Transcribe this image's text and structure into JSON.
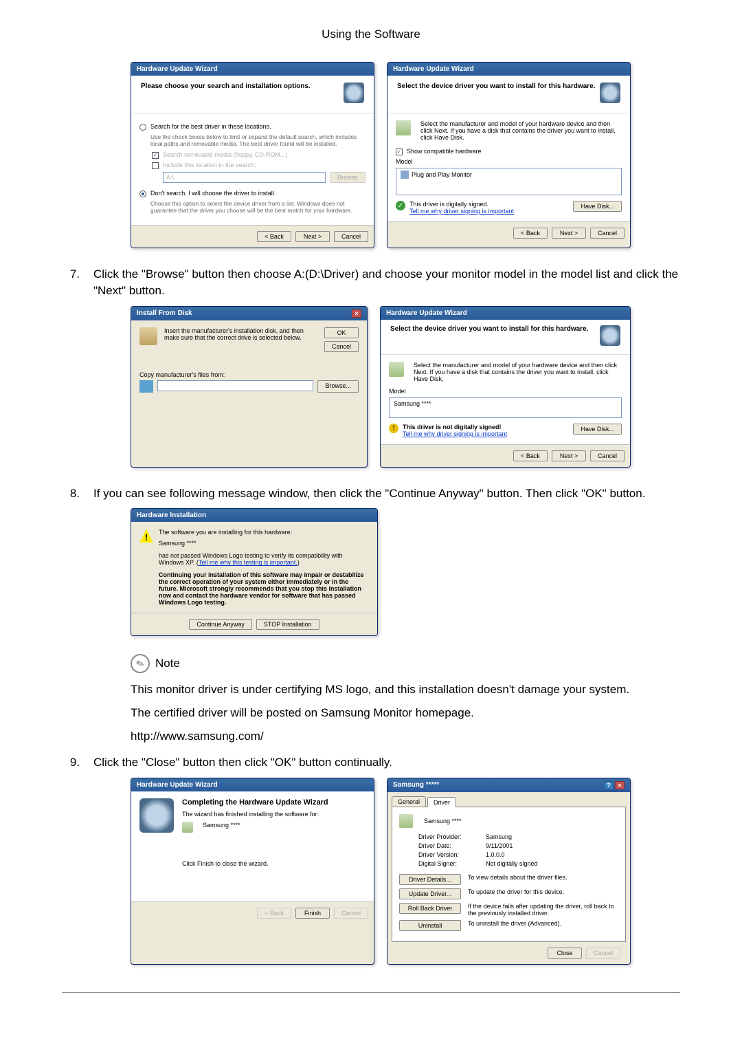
{
  "page_title": "Using the Software",
  "dlg1": {
    "title": "Hardware Update Wizard",
    "heading": "Please choose your search and installation options.",
    "radio1": "Search for the best driver in these locations.",
    "radio1_sub": "Use the check boxes below to limit or expand the default search, which includes local paths and removable media. The best driver found will be installed.",
    "chk1": "Search removable media (floppy, CD-ROM...)",
    "chk2": "Include this location in the search:",
    "path": "A:\\",
    "browse": "Browse",
    "radio2": "Don't search. I will choose the driver to install.",
    "radio2_sub": "Choose this option to select the device driver from a list. Windows does not guarantee that the driver you choose will be the best match for your hardware.",
    "back": "< Back",
    "next": "Next >",
    "cancel": "Cancel"
  },
  "dlg2": {
    "title": "Hardware Update Wizard",
    "heading": "Select the device driver you want to install for this hardware.",
    "instruction": "Select the manufacturer and model of your hardware device and then click Next. If you have a disk that contains the driver you want to install, click Have Disk.",
    "show_compat": "Show compatible hardware",
    "model_lbl": "Model",
    "model_item": "Plug and Play Monitor",
    "signed": "This driver is digitally signed.",
    "tell_me": "Tell me why driver signing is important",
    "have_disk": "Have Disk...",
    "back": "< Back",
    "next": "Next >",
    "cancel": "Cancel"
  },
  "step7": "Click the \"Browse\" button then choose A:(D:\\Driver) and choose your monitor model in the model list and click the \"Next\" button.",
  "dlg3": {
    "title": "Install From Disk",
    "instruction": "Insert the manufacturer's installation disk, and then make sure that the correct drive is selected below.",
    "ok": "OK",
    "cancel": "Cancel",
    "copy_from": "Copy manufacturer's files from:",
    "path": "",
    "browse": "Browse..."
  },
  "dlg4": {
    "title": "Hardware Update Wizard",
    "heading": "Select the device driver you want to install for this hardware.",
    "instruction": "Select the manufacturer and model of your hardware device and then click Next. If you have a disk that contains the driver you want to install, click Have Disk.",
    "model_lbl": "Model",
    "model_item": "Samsung ****",
    "not_signed": "This driver is not digitally signed!",
    "tell_me": "Tell me why driver signing is important",
    "have_disk": "Have Disk...",
    "back": "< Back",
    "next": "Next >",
    "cancel": "Cancel"
  },
  "step8": "If you can see following message window, then click the \"Continue Anyway\" button. Then click \"OK\" button.",
  "dlg5": {
    "title": "Hardware Installation",
    "line1": "The software you are installing for this hardware:",
    "device": "Samsung ****",
    "line2a": "has not passed Windows Logo testing to verify its compatibility with Windows XP. (",
    "line2link": "Tell me why this testing is important.",
    "line2b": ")",
    "bold_text": "Continuing your installation of this software may impair or destabilize the correct operation of your system either immediately or in the future. Microsoft strongly recommends that you stop this installation now and contact the hardware vendor for software that has passed Windows Logo testing.",
    "cont": "Continue Anyway",
    "stop": "STOP Installation"
  },
  "note_label": "Note",
  "note_p1": "This monitor driver is under certifying MS logo, and this installation doesn't damage your system.",
  "note_p2": "The certified driver will be posted on Samsung Monitor homepage.",
  "note_url": "http://www.samsung.com/",
  "step9": "Click the \"Close\" button then click \"OK\" button continually.",
  "dlg6": {
    "title": "Hardware Update Wizard",
    "heading": "Completing the Hardware Update Wizard",
    "line1": "The wizard has finished installing the software for:",
    "device": "Samsung ****",
    "line2": "Click Finish to close the wizard.",
    "back": "< Back",
    "finish": "Finish",
    "cancel": "Cancel"
  },
  "dlg7": {
    "title": "Samsung *****",
    "tab_general": "General",
    "tab_driver": "Driver",
    "device": "Samsung ****",
    "provider_lbl": "Driver Provider:",
    "provider": "Samsung",
    "date_lbl": "Driver Date:",
    "date": "9/11/2001",
    "version_lbl": "Driver Version:",
    "version": "1.0.0.0",
    "signer_lbl": "Digital Signer:",
    "signer": "Not digitally signed",
    "btn_details": "Driver Details...",
    "btn_details_desc": "To view details about the driver files.",
    "btn_update": "Update Driver...",
    "btn_update_desc": "To update the driver for this device.",
    "btn_rollback": "Roll Back Driver",
    "btn_rollback_desc": "If the device fails after updating the driver, roll back to the previously installed driver.",
    "btn_uninstall": "Uninstall",
    "btn_uninstall_desc": "To uninstall the driver (Advanced).",
    "close": "Close",
    "cancel": "Cancel"
  }
}
